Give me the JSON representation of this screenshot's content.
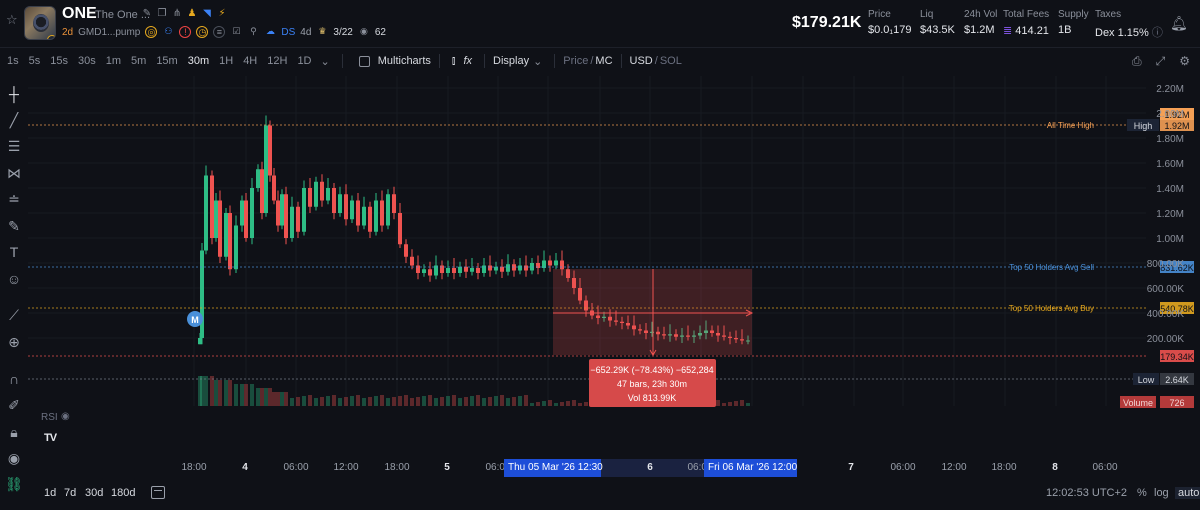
{
  "header": {
    "ticker": "ONE",
    "token_name": "The One ...",
    "age": "2d",
    "contract": "GMD1...pump",
    "ds_label": "DS",
    "ds_value": "4d",
    "top_holders": "3/22",
    "watchers": "62",
    "market_cap": "$179.21K",
    "stats": [
      {
        "label": "Price",
        "value": "$0.0₁179"
      },
      {
        "label": "Liq",
        "value": "$43.5K"
      },
      {
        "label": "24h Vol",
        "value": "$1.2M"
      },
      {
        "label": "Total Fees",
        "value": "414.21"
      },
      {
        "label": "Supply",
        "value": "1B"
      },
      {
        "label": "Taxes",
        "value": "Dex 1.15%"
      }
    ]
  },
  "toolbar": {
    "timeframes": [
      "1s",
      "5s",
      "15s",
      "30s",
      "1m",
      "5m",
      "15m",
      "30m",
      "1H",
      "4H",
      "12H",
      "1D"
    ],
    "active_timeframe": "30m",
    "multicharts": "Multicharts",
    "display": "Display",
    "price_label": "Price",
    "mc_label": "MC",
    "usd_label": "USD",
    "sol_label": "SOL"
  },
  "chart": {
    "price_axis": [
      "2.20M",
      "2.00M",
      "1.80M",
      "1.60M",
      "1.40M",
      "1.20M",
      "1.00M",
      "800.00K",
      "600.00K",
      "400.00K",
      "200.00K"
    ],
    "lines": [
      {
        "label": "All Time High",
        "tag": "High",
        "value": "1.92M",
        "color": "#f5a055"
      },
      {
        "label": "Top 50 Holders Avg Sell",
        "value": "831.62K",
        "color": "#4a90d9"
      },
      {
        "label": "Top 50 Holders Avg Buy",
        "value": "540.78K",
        "color": "#e5a81f"
      },
      {
        "label": "Current",
        "value": "179.34K",
        "color": "#ef5350"
      },
      {
        "label": "Low",
        "tag": "Low",
        "value": "2.64K",
        "color": "#7b808c"
      }
    ],
    "ath_top_value": "1.92M",
    "volume_label": "Volume",
    "volume_value": "726",
    "marker": "M",
    "measure": {
      "change": "−652.29K (−78.43%) −652,284",
      "bars": "47 bars, 23h 30m",
      "vol": "Vol 813.99K"
    },
    "time_axis": [
      "18:00",
      "4",
      "06:00",
      "12:00",
      "18:00",
      "5",
      "06:00",
      "6",
      "06:00",
      "12:00",
      "7",
      "06:00",
      "12:00",
      "18:00",
      "8",
      "06:00"
    ],
    "range_start": "Thu 05 Mar '26",
    "range_start_time": "12:30",
    "range_end": "Fri 06 Mar '26",
    "range_end_time": "12:00",
    "indicator": "RSI"
  },
  "bottom": {
    "ranges": [
      "1d",
      "7d",
      "30d",
      "180d"
    ],
    "clock": "12:02:53 UTC+2",
    "percent": "%",
    "log": "log",
    "auto": "auto"
  }
}
